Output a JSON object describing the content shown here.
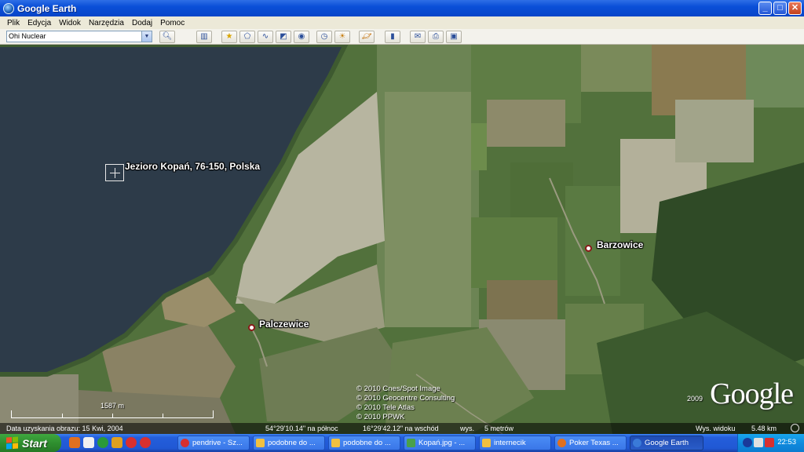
{
  "window": {
    "title": "Google Earth"
  },
  "menu": [
    "Plik",
    "Edycja",
    "Widok",
    "Narzędzia",
    "Dodaj",
    "Pomoc"
  ],
  "search": {
    "value": "Ohi Nuclear"
  },
  "toolbar_icons": [
    "search-icon",
    "sidebar-toggle-icon",
    "placemark-icon",
    "polygon-icon",
    "path-icon",
    "image-overlay-icon",
    "record-tour-icon",
    "historical-imagery-icon",
    "sunlight-icon",
    "planets-icon",
    "ruler-icon",
    "email-icon",
    "print-icon",
    "save-image-icon"
  ],
  "map": {
    "labels": {
      "lake": "Jezioro Kopań, 76-150, Polska",
      "barzowice": "Barzowice",
      "palczewice": "Palczewice"
    },
    "copyright": [
      "© 2010 Cnes/Spot Image",
      "© 2010 Geocentre Consulting",
      "© 2010 Tele Atlas",
      "© 2010 PPWK"
    ],
    "logo": "Google",
    "logo_year": "2009",
    "scale": "1587 m"
  },
  "status": {
    "date": "Data uzyskania obrazu: 15 Kwi, 2004",
    "lat": "54°29'10.14\" na północ",
    "lon": "16°29'42.12\" na wschód",
    "elev_label": "wys.",
    "elev_value": "5 metrów",
    "eye_label": "Wys. widoku",
    "eye_value": "5.48 km"
  },
  "taskbar": {
    "start": "Start",
    "tasks": [
      "pendrive - Sz...",
      "podobne do ...",
      "podobne do ...",
      "Kopań.jpg - ...",
      "internecik",
      "Poker Texas ...",
      "Google Earth"
    ],
    "clock": "22:53"
  },
  "colors": {
    "title_bar": "#0a4fd8",
    "lake": "#2c3a48",
    "fields": "#5a7a3e",
    "taskbar": "#245edb",
    "start": "#2f8f2f",
    "place_dot_border": "#8a1a1a"
  }
}
